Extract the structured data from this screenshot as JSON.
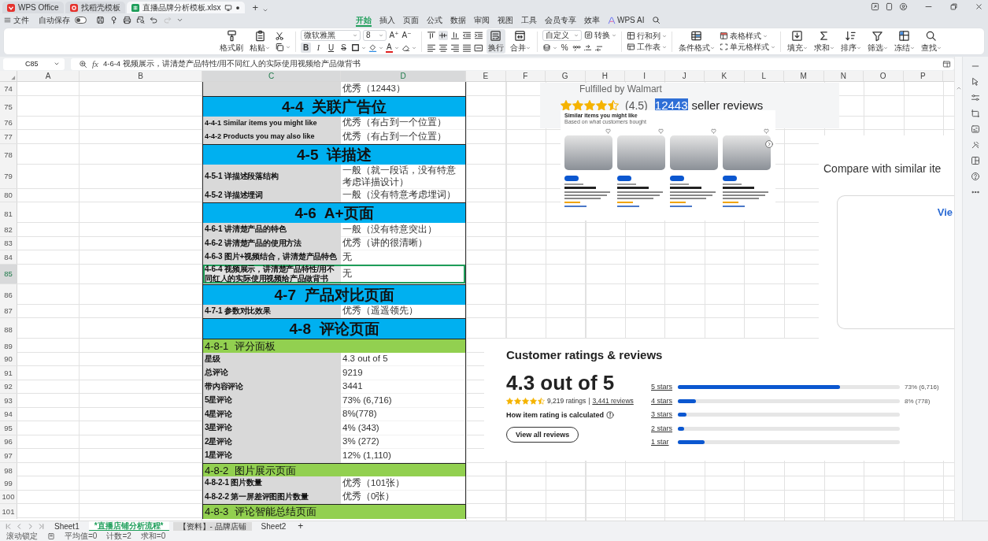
{
  "title_bar": {
    "tabs": [
      {
        "kind": "wps",
        "label": "WPS Office",
        "selected": false
      },
      {
        "kind": "docer",
        "label": "找稻壳模板",
        "selected": false
      },
      {
        "kind": "sheet",
        "label": "直播品牌分析模板.xlsx",
        "selected": true
      }
    ],
    "new_tab": "+"
  },
  "menu_bar": {
    "file": "文件",
    "autosave": {
      "label": "自动保存",
      "on": false
    },
    "undo": {
      "disabled": false
    },
    "redo": {
      "disabled": true
    },
    "tabs": [
      {
        "kind": "text",
        "label": "开始",
        "selected": true
      },
      {
        "kind": "text",
        "label": "插入",
        "selected": false
      },
      {
        "kind": "text",
        "label": "页面",
        "selected": false
      },
      {
        "kind": "text",
        "label": "公式",
        "selected": false
      },
      {
        "kind": "text",
        "label": "数据",
        "selected": false
      },
      {
        "kind": "text",
        "label": "审阅",
        "selected": false
      },
      {
        "kind": "text",
        "label": "视图",
        "selected": false
      },
      {
        "kind": "text",
        "label": "工具",
        "selected": false
      },
      {
        "kind": "text",
        "label": "会员专享",
        "selected": false
      },
      {
        "kind": "text",
        "label": "效率",
        "selected": false
      },
      {
        "kind": "ai",
        "label": "WPS AI",
        "selected": false
      }
    ]
  },
  "ribbon": {
    "clipboard": [
      "格式刷",
      "粘贴"
    ],
    "font": {
      "name": "微软雅黑",
      "size": "8",
      "size_buttons": [
        "A⁺",
        "A⁻"
      ],
      "styles": [
        {
          "kind": "bold",
          "label": "B",
          "on": true
        },
        {
          "kind": "italic",
          "label": "I",
          "on": false
        },
        {
          "kind": "underline",
          "label": "U",
          "on": false
        },
        {
          "kind": "strike",
          "label": "S",
          "on": false
        }
      ],
      "color_label": "A"
    },
    "align": [
      {
        "on": false
      },
      {
        "on": true
      },
      {
        "on": false
      },
      {
        "on": false
      },
      {
        "on": false
      },
      {
        "on": false
      },
      {
        "on": false
      },
      {
        "on": false
      },
      {
        "on": false
      },
      {
        "on": false
      }
    ],
    "wrap": {
      "label": "换行",
      "on": true
    },
    "merge": "合并",
    "number_format": "自定义",
    "convert": "转换",
    "percent": "%",
    "rows_cols": "行和列",
    "worksheet": "工作表",
    "conditional_format": "条件格式",
    "table_style": "表格样式",
    "cell_style": "单元格样式",
    "tools": [
      "填充",
      "求和",
      "排序",
      "筛选",
      "冻结",
      "查找"
    ]
  },
  "formula_bar": {
    "cell": "C85",
    "fx": "fx",
    "formula": "4-6-4 视频展示，讲清楚产品特性/用不同红人的实际使用视频给产品做背书"
  },
  "sheet": {
    "columns": [
      {
        "label": "A",
        "selected": false
      },
      {
        "label": "B",
        "selected": false
      },
      {
        "label": "C",
        "selected": true
      },
      {
        "label": "D",
        "selected": true
      },
      {
        "label": "E",
        "selected": false
      },
      {
        "label": "F",
        "selected": false
      },
      {
        "label": "G",
        "selected": false
      },
      {
        "label": "H",
        "selected": false
      },
      {
        "label": "I",
        "selected": false
      },
      {
        "label": "J",
        "selected": false
      },
      {
        "label": "K",
        "selected": false
      },
      {
        "label": "L",
        "selected": false
      },
      {
        "label": "M",
        "selected": false
      },
      {
        "label": "N",
        "selected": false
      },
      {
        "label": "O",
        "selected": false
      },
      {
        "label": "P",
        "selected": false
      }
    ],
    "rows": [
      {
        "number": "74",
        "kind": "item",
        "selected": false,
        "d": "优秀（12443）"
      },
      {
        "number": "75",
        "kind": "section",
        "selected": false,
        "title": "4-4  关联广告位"
      },
      {
        "number": "76",
        "kind": "item",
        "selected": false,
        "c": "4-4-1 Similar items you might like",
        "d": "优秀（有占到一个位置）"
      },
      {
        "number": "77",
        "kind": "item",
        "selected": false,
        "c": "4-4-2 Products you may also like",
        "d": "优秀（有占到一个位置）"
      },
      {
        "number": "78",
        "kind": "section",
        "selected": false,
        "title": "4-5  详描述"
      },
      {
        "number": "79",
        "kind": "item",
        "selected": false,
        "c": "4-5-1 详描述段落结构",
        "d": "一般（就一段话，没有特意考虑详描设计）"
      },
      {
        "number": "80",
        "kind": "item",
        "selected": false,
        "c": "4-5-2 详描述埋词",
        "d": "一般（没有特意考虑埋词）"
      },
      {
        "number": "81",
        "kind": "section",
        "selected": false,
        "title": "4-6  A+页面"
      },
      {
        "number": "82",
        "kind": "item",
        "selected": false,
        "c": "4-6-1 讲清楚产品的特色",
        "d": "一般（没有特意突出）"
      },
      {
        "number": "83",
        "kind": "item",
        "selected": false,
        "c": "4-6-2 讲清楚产品的使用方法",
        "d": "优秀（讲的很清晰）"
      },
      {
        "number": "84",
        "kind": "item",
        "selected": false,
        "c": "4-6-3 图片+视频结合，讲清楚产品特色",
        "d": "无"
      },
      {
        "number": "85",
        "kind": "item",
        "selected": true,
        "c": "4-6-4 视频展示，讲清楚产品特性/用不同红人的实际使用视频给产品做背书",
        "d": "无"
      },
      {
        "number": "86",
        "kind": "section",
        "selected": false,
        "title": "4-7  产品对比页面"
      },
      {
        "number": "87",
        "kind": "item",
        "selected": false,
        "c": "4-7-1 参数对比效果",
        "d": "优秀（遥遥领先）"
      },
      {
        "number": "88",
        "kind": "section",
        "selected": false,
        "title": "4-8  评论页面"
      },
      {
        "number": "89",
        "kind": "subsection",
        "selected": false,
        "title": "4-8-1  评分面板"
      },
      {
        "number": "90",
        "kind": "item",
        "selected": false,
        "c": "星级",
        "d": "4.3 out of 5"
      },
      {
        "number": "91",
        "kind": "item",
        "selected": false,
        "c": "总评论",
        "d": "9219"
      },
      {
        "number": "92",
        "kind": "item",
        "selected": false,
        "c": "带内容评论",
        "d": "3441"
      },
      {
        "number": "93",
        "kind": "item",
        "selected": false,
        "c": "5星评论",
        "d": "73% (6,716)"
      },
      {
        "number": "94",
        "kind": "item",
        "selected": false,
        "c": "4星评论",
        "d": "8%(778)"
      },
      {
        "number": "95",
        "kind": "item",
        "selected": false,
        "c": "3星评论",
        "d": "4% (343)"
      },
      {
        "number": "96",
        "kind": "item",
        "selected": false,
        "c": "2星评论",
        "d": "3% (272)"
      },
      {
        "number": "97",
        "kind": "item",
        "selected": false,
        "c": "1星评论",
        "d": "12% (1,110)"
      },
      {
        "number": "98",
        "kind": "subsection",
        "selected": false,
        "title": "4-8-2  图片展示页面"
      },
      {
        "number": "99",
        "kind": "item",
        "selected": false,
        "c": "4-8-2-1 图片数量",
        "d": "优秀（101张）"
      },
      {
        "number": "100",
        "kind": "item",
        "selected": false,
        "c": "4-8-2-2 第一屏差评图图片数量",
        "d": "优秀（0张）"
      },
      {
        "number": "101",
        "kind": "subsection",
        "selected": false,
        "title": "4-8-3  评论智能总结页面"
      }
    ]
  },
  "images": [
    {
      "kind": "seller_rating",
      "caption": "Fulfilled by Walmart",
      "stars": 4.5,
      "rating": "(4.5)",
      "count": {
        "text": "12443",
        "highlighted": true
      },
      "suffix": "seller reviews"
    },
    {
      "kind": "carousel",
      "title": "Similar items you might like",
      "subtitle": "Based on what customers bought"
    },
    {
      "kind": "compare",
      "title": "Compare with similar ite",
      "link": "Vie"
    },
    {
      "kind": "customer_ratings",
      "title": "Customer ratings & reviews",
      "score": "4.3 out of 5",
      "stars": 4.5,
      "ratings": "9,219 ratings",
      "separator": "|",
      "reviews": "3,441 reviews",
      "how": "How item rating is calculated",
      "button": "View all reviews",
      "bars": [
        {
          "label": "5 stars",
          "level": 0.73,
          "reading": "73% (6,716)"
        },
        {
          "label": "4 stars",
          "level": 0.08,
          "reading": "8% (778)"
        },
        {
          "label": "3 stars",
          "level": 0.04
        },
        {
          "label": "2 stars",
          "level": 0.03
        },
        {
          "label": "1 star",
          "level": 0.12
        }
      ]
    }
  ],
  "sheet_tabs": {
    "tabs": [
      {
        "label": "Sheet1",
        "selected": false
      },
      {
        "label": "*直播店铺分析流程*",
        "selected": true
      },
      {
        "label": "【资料】- 品牌店铺",
        "selected": false,
        "color": "#dcdcdc"
      },
      {
        "label": "Sheet2",
        "selected": false
      }
    ],
    "add": "+"
  },
  "status_bar": {
    "items": [
      "滚动锁定",
      "平均值=0",
      "计数=2",
      "求和=0"
    ]
  }
}
